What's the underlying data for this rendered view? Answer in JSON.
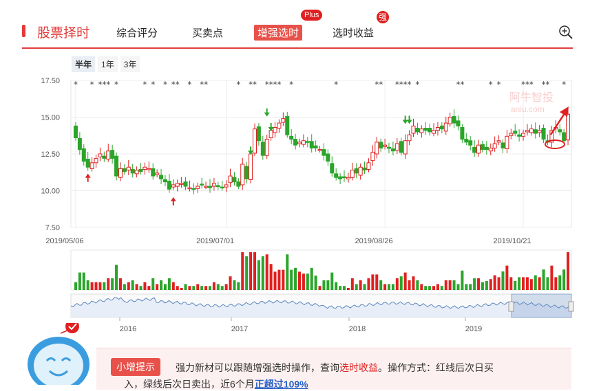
{
  "header": {
    "title": "股票择时",
    "tabs": [
      {
        "label": "综合评分",
        "active": false
      },
      {
        "label": "买卖点",
        "active": false
      },
      {
        "label": "增强选时",
        "active": true,
        "badge": "Plus"
      },
      {
        "label": "选时收益",
        "active": false,
        "badge": "强"
      }
    ],
    "zoom_icon": "zoom-in-icon"
  },
  "ranges": [
    {
      "label": "半年",
      "selected": true
    },
    {
      "label": "1年",
      "selected": false
    },
    {
      "label": "3年",
      "selected": false
    }
  ],
  "colors": {
    "up": "#e02020",
    "down": "#2aa52a",
    "accent": "#e33b3b",
    "navigator": "#5a86c0"
  },
  "chart_data": {
    "type": "candlestick",
    "y_ticks": [
      "17.50",
      "15.00",
      "12.50",
      "10.00",
      "7.50"
    ],
    "ylim": [
      7.5,
      17.5
    ],
    "x_labels": [
      "2019/05/06",
      "2019/07/01",
      "2019/08/26",
      "2019/10/21"
    ],
    "x_label_index": [
      0,
      37,
      76,
      110
    ],
    "closes": [
      13.6,
      12.8,
      12.0,
      11.6,
      11.9,
      12.2,
      12.5,
      12.2,
      12.7,
      12.2,
      11.0,
      11.5,
      11.3,
      11.6,
      11.2,
      11.4,
      11.3,
      11.6,
      11.5,
      11.0,
      11.2,
      10.8,
      10.6,
      10.1,
      10.4,
      10.5,
      10.5,
      10.3,
      10.2,
      10.1,
      10.3,
      10.4,
      10.3,
      10.2,
      10.5,
      10.3,
      10.2,
      10.4,
      11.0,
      10.6,
      10.3,
      11.8,
      10.8,
      12.5,
      14.2,
      13.4,
      12.4,
      13.5,
      14.1,
      14.3,
      14.6,
      14.9,
      13.8,
      13.5,
      13.1,
      13.3,
      13.4,
      13.3,
      12.9,
      12.9,
      12.8,
      12.4,
      12.0,
      11.2,
      10.9,
      10.8,
      10.9,
      10.9,
      11.4,
      11.2,
      11.6,
      11.4,
      11.9,
      12.6,
      13.3,
      12.9,
      13.1,
      12.9,
      12.7,
      13.2,
      12.6,
      13.4,
      13.8,
      14.4,
      14.0,
      14.2,
      14.1,
      14.0,
      14.1,
      14.3,
      14.2,
      14.6,
      15.0,
      14.6,
      14.4,
      13.5,
      13.3,
      13.1,
      12.6,
      13.1,
      12.8,
      12.8,
      12.9,
      13.2,
      13.4,
      12.9,
      13.7,
      13.9,
      13.9,
      13.7,
      13.9,
      14.1,
      14.2,
      13.9,
      14.1,
      13.5,
      13.3,
      14.1,
      14.3,
      14.0,
      13.4,
      15.2
    ],
    "sell_star_rows": "★ markers along top row",
    "volume_label": "volume bars",
    "navigator_years": [
      "2016",
      "2017",
      "2018",
      "2019"
    ],
    "watermark": "阿牛智投",
    "watermark_sub": "aniu.com"
  },
  "tip": {
    "label": "小增提示",
    "text_before": "强力新材可以跟随增强选时操作，查询",
    "text_link": "选时收益",
    "text_after": "。操作方式：红线后次日买",
    "line2_before": "入，绿线后次日卖出，近6个月",
    "line2_link": "正超过109%"
  }
}
